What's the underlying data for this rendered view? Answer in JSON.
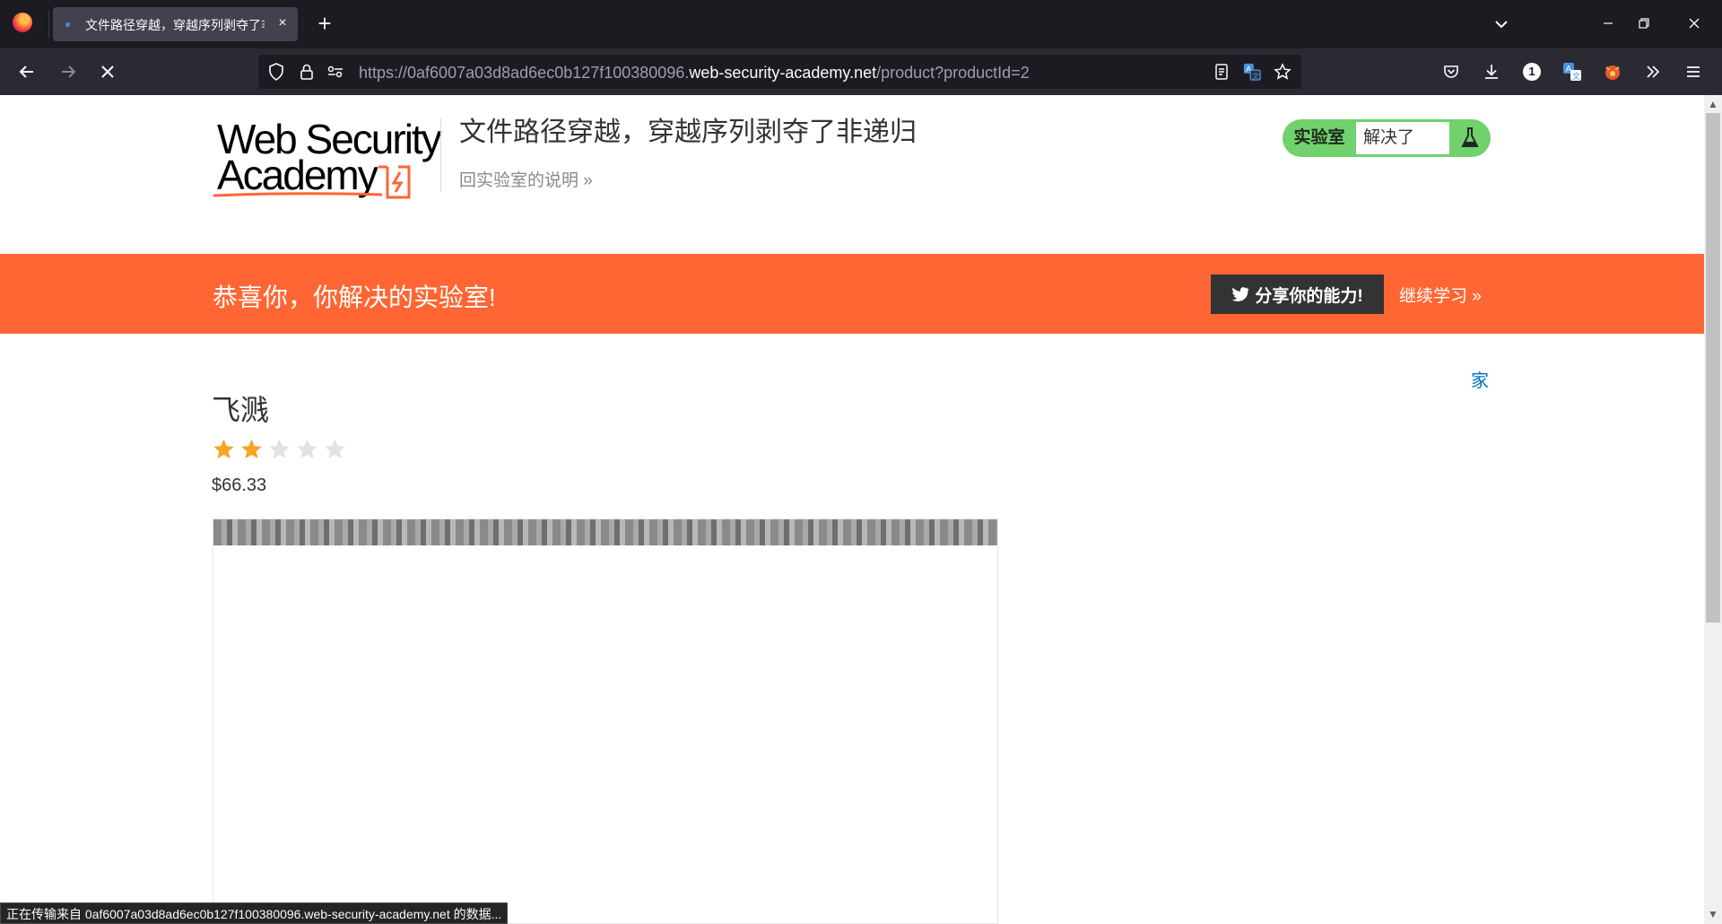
{
  "browser": {
    "tab_title": "文件路径穿越，穿越序列剥夺了非递归",
    "tab_close": "×",
    "new_tab": "+",
    "url_prefix": "https://0af6007a03d8ad6ec0b127f100380096.",
    "url_host": "web-security-academy.net",
    "url_path": "/product?productId=2",
    "extension_badge": "1",
    "status_bar": "正在传输来自 0af6007a03d8ad6ec0b127f100380096.web-security-academy.net 的数据..."
  },
  "header": {
    "logo_line1": "Web Security",
    "logo_line2": "Academy",
    "lab_title": "文件路径穿越，穿越序列剥夺了非递归",
    "back_link": "回实验室的说明 »",
    "status_label": "实验室",
    "status_value": "解决了"
  },
  "banner": {
    "message": "恭喜你，你解决的实验室!",
    "share_button": "分享你的能力!",
    "continue_link": "继续学习 »"
  },
  "product": {
    "home_link": "家",
    "name": "飞溅",
    "rating": 2,
    "rating_max": 5,
    "price": "$66.33"
  },
  "colors": {
    "accent_orange": "#ff6633",
    "status_green": "#70d16d",
    "star_filled": "#f5a623",
    "star_empty": "#dde3e6",
    "link_blue": "#0071bc"
  }
}
